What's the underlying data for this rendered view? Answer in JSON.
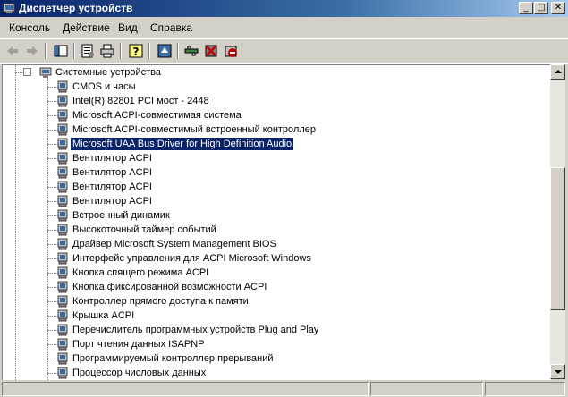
{
  "window": {
    "title": "Диспетчер устройств",
    "minimize_glyph": "_",
    "maximize_glyph": "□",
    "close_glyph": "✕"
  },
  "menu": [
    {
      "label": "Консоль"
    },
    {
      "label": "Действие"
    },
    {
      "label": "Вид"
    },
    {
      "label": "Справка"
    }
  ],
  "toolbar": {
    "icons": [
      "back-arrow-icon",
      "forward-arrow-icon",
      "show-hide-tree-icon",
      "properties-icon",
      "print-icon",
      "help-icon",
      "scan-hardware-icon",
      "update-driver-icon",
      "disable-device-icon",
      "uninstall-device-icon"
    ]
  },
  "tree": {
    "category": "Системные устройства",
    "items": [
      {
        "label": "CMOS и часы"
      },
      {
        "label": "Intel(R) 82801 PCI мост - 2448"
      },
      {
        "label": "Microsoft ACPI-совместимая система"
      },
      {
        "label": "Microsoft ACPI-совместимый встроенный контроллер"
      },
      {
        "label": "Microsoft UAA Bus Driver for High Definition Audio",
        "selected": true
      },
      {
        "label": "Вентилятор ACPI"
      },
      {
        "label": "Вентилятор ACPI"
      },
      {
        "label": "Вентилятор ACPI"
      },
      {
        "label": "Вентилятор ACPI"
      },
      {
        "label": "Встроенный динамик"
      },
      {
        "label": "Высокоточный таймер событий"
      },
      {
        "label": "Драйвер Microsoft System Management BIOS"
      },
      {
        "label": "Интерфейс управления для ACPI Microsoft Windows"
      },
      {
        "label": "Кнопка спящего режима ACPI"
      },
      {
        "label": "Кнопка фиксированной возможности ACPI"
      },
      {
        "label": "Контроллер прямого доступа к памяти"
      },
      {
        "label": "Крышка ACPI"
      },
      {
        "label": "Перечислитель программных устройств Plug and Play"
      },
      {
        "label": "Порт чтения данных ISAPNP"
      },
      {
        "label": "Программируемый контроллер прерываний"
      },
      {
        "label": "Процессор числовых данных"
      }
    ]
  },
  "colors": {
    "title_gradient_start": "#0a246a",
    "selection": "#0a246a",
    "face": "#d4d0c8"
  }
}
